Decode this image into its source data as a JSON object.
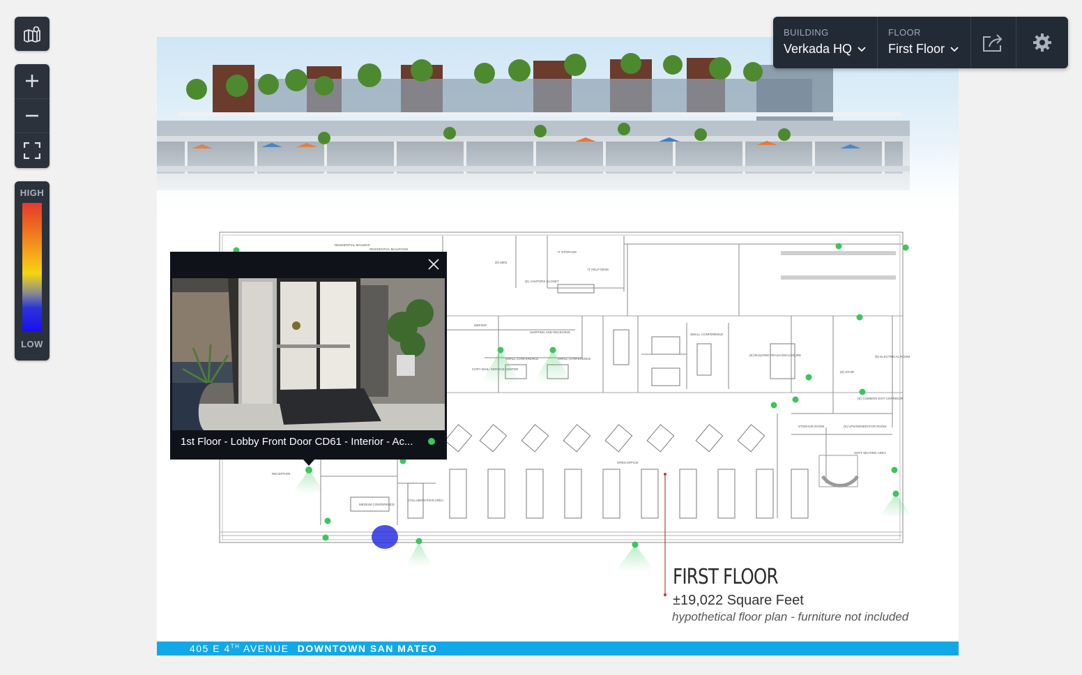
{
  "toolbar": {
    "map_icon": "map-icon",
    "zoom_in_icon": "plus-icon",
    "zoom_out_icon": "minus-icon",
    "fit_icon": "fullscreen-icon"
  },
  "heatmap_legend": {
    "high_label": "HIGH",
    "low_label": "LOW",
    "colors": [
      "#e53a2b",
      "#ef6d1f",
      "#f5a21b",
      "#f4d512",
      "#8b8d8b",
      "#2b33d9",
      "#1a10f0"
    ]
  },
  "picker": {
    "building_label": "BUILDING",
    "building_value": "Verkada HQ",
    "floor_label": "FLOOR",
    "floor_value": "First Floor",
    "share_icon": "share-icon",
    "settings_icon": "gear-icon"
  },
  "floorplan": {
    "title": "FIRST FLOOR",
    "sqft": "±19,022 Square Feet",
    "note": "hypothetical floor plan - furniture not included",
    "address": "405 E 4",
    "address_sup": "TH",
    "address_rest": " AVENUE",
    "city": "DOWNTOWN SAN MATEO",
    "accent_color": "#12a8e8",
    "camera_color": "#3cc55d",
    "room_labels": [
      "RESIDENTIAL MAILBOX",
      "RESIDENTIAL MAILROOM",
      "(E) MEN",
      "(E) JANITORS CLOSET",
      "IT STORAGE",
      "IT HELP DESK",
      "MDF/IDF",
      "SHIPPING AND RECEIVING",
      "COPY MAIL/ SERVICE CENTER",
      "SMALL CONFERENCE",
      "SMALL CONFERENCE",
      "SMALL CONFERENCE",
      "(E) BUILDING TRASH ENCLOSURE",
      "(E) STAIR",
      "(E) ELECTRICAL ROOM",
      "(E) COMMON EXIT CORRIDOR",
      "STORAGE ROOM",
      "(E) UPS/GENERATOR ROOM",
      "SOFT SEATING AREA",
      "OPEN OFFICE",
      "RECEPTION",
      "MEDIUM CONFERENCE",
      "COLLABORATION AREA"
    ]
  },
  "camera_popup": {
    "caption": "1st Floor - Lobby Front Door CD61 - Interior - Ac...",
    "status": "online",
    "close_icon": "close-icon"
  }
}
